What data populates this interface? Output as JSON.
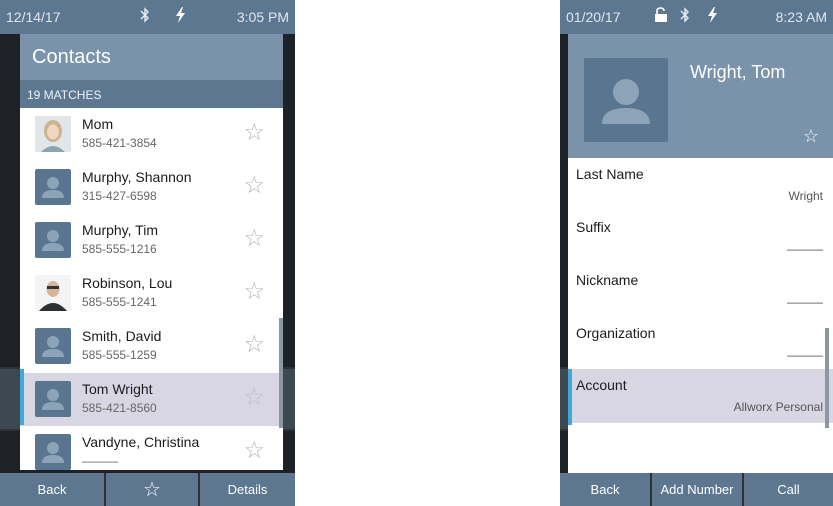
{
  "left_screen": {
    "status": {
      "date": "12/14/17",
      "time": "3:05 PM",
      "icons": [
        "bluetooth-icon",
        "power-bolt-icon"
      ]
    },
    "title": "Contacts",
    "matches": "19 MATCHES",
    "contacts": [
      {
        "name": "Mom",
        "phone": "585-421-3854",
        "avatar": "photo-woman",
        "favorite": false
      },
      {
        "name": "Murphy, Shannon",
        "phone": "315-427-6598",
        "avatar": "default-person",
        "favorite": false
      },
      {
        "name": "Murphy, Tim",
        "phone": "585-555-1216",
        "avatar": "default-person",
        "favorite": false
      },
      {
        "name": "Robinson, Lou",
        "phone": "585-555-1241",
        "avatar": "photo-man",
        "favorite": false
      },
      {
        "name": "Smith, David",
        "phone": "585-555-1259",
        "avatar": "default-person",
        "favorite": false
      },
      {
        "name": "Tom Wright",
        "phone": "585-421-8560",
        "avatar": "default-person",
        "favorite": false,
        "selected": true
      },
      {
        "name": "Vandyne, Christina",
        "phone": "———",
        "avatar": "default-person",
        "favorite": false
      }
    ],
    "buttons": {
      "back": "Back",
      "favorite": "☆",
      "details": "Details"
    }
  },
  "right_screen": {
    "status": {
      "date": "01/20/17",
      "time": "8:23 AM",
      "icons": [
        "unlock-icon",
        "bluetooth-icon",
        "power-bolt-icon"
      ]
    },
    "profile_name": "Wright, Tom",
    "fields": [
      {
        "label": "Last Name",
        "value": "Wright"
      },
      {
        "label": "Suffix",
        "value": "———"
      },
      {
        "label": "Nickname",
        "value": "———"
      },
      {
        "label": "Organization",
        "value": "———"
      },
      {
        "label": "Account",
        "value": "Allworx Personal",
        "selected": true
      }
    ],
    "buttons": {
      "back": "Back",
      "add_number": "Add Number",
      "call": "Call"
    }
  },
  "colors": {
    "header_blue": "#7a93aa",
    "bar_blue": "#5d7791",
    "selected_row": "#d9d6e4",
    "accent": "#3fa9d8"
  }
}
